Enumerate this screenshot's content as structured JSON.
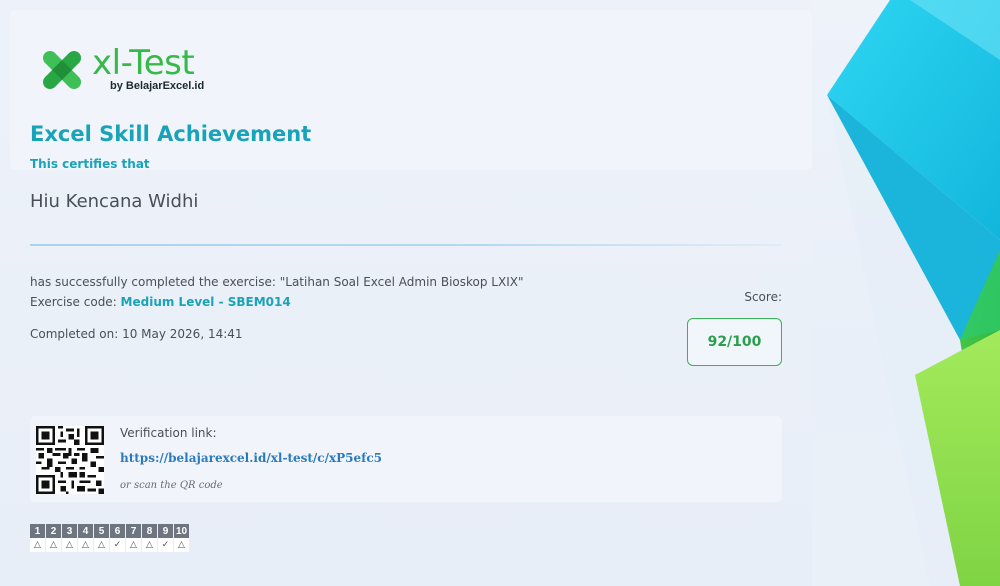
{
  "logo": {
    "title": "xl-Test",
    "subtitle": "by BelajarExcel.id",
    "colors": {
      "green": "#37b94a",
      "dark_green": "#1f8f3a"
    }
  },
  "certificate": {
    "title": "Excel Skill Achievement",
    "certifies_label": "This certifies that",
    "recipient_name": "Hiu Kencana Widhi",
    "completed_text": "has successfully completed the exercise: \"Latihan Soal Excel Admin Bioskop LXIX\"",
    "exercise_code_label": "Exercise code: ",
    "exercise_code_value": "Medium Level - SBEM014",
    "completed_on": "Completed on: 10 May 2026, 14:41"
  },
  "score": {
    "label": "Score:",
    "value": "92/100"
  },
  "verification": {
    "label": "Verification link:",
    "link": "https://belajarexcel.id/xl-test/c/xP5efc5",
    "hint": "or scan the QR code"
  },
  "questions": [
    {
      "num": "1",
      "mark": "△"
    },
    {
      "num": "2",
      "mark": "△"
    },
    {
      "num": "3",
      "mark": "△"
    },
    {
      "num": "4",
      "mark": "△"
    },
    {
      "num": "5",
      "mark": "△"
    },
    {
      "num": "6",
      "mark": "✓"
    },
    {
      "num": "7",
      "mark": "△"
    },
    {
      "num": "8",
      "mark": "△"
    },
    {
      "num": "9",
      "mark": "✓"
    },
    {
      "num": "10",
      "mark": "△"
    }
  ],
  "colors": {
    "accent_teal": "#19a3b8",
    "score_green": "#39b25a",
    "link_blue": "#2a7bbd",
    "deco_cyan": "#1fc8ea",
    "deco_green": "#39c03f",
    "deco_lime": "#8ee04a"
  },
  "icons": {
    "logo": "xl-test-logo-icon",
    "qr": "qr-code-icon"
  }
}
